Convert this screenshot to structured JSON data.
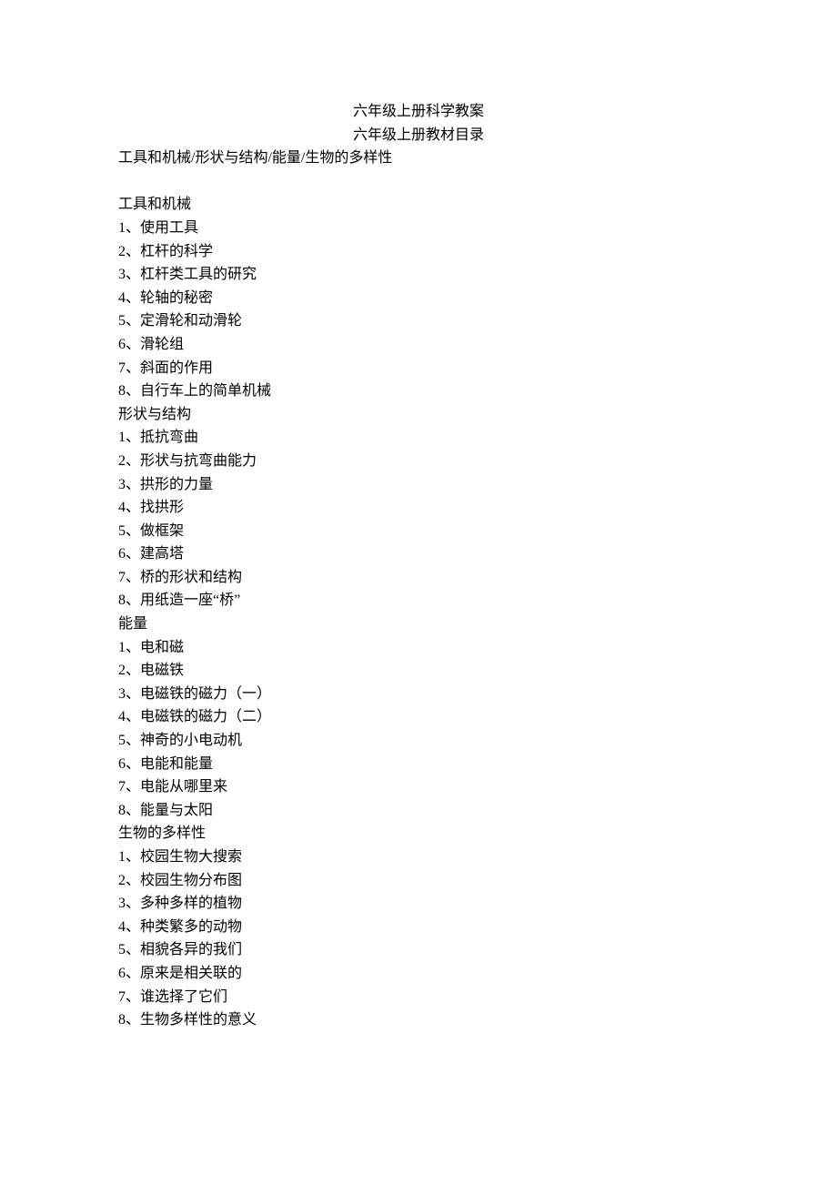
{
  "titles": {
    "main": "六年级上册科学教案",
    "sub": "六年级上册教材目录"
  },
  "summary": "工具和机械/形状与结构/能量/生物的多样性",
  "sections": [
    {
      "heading": "工具和机械",
      "items": [
        "1、使用工具",
        "2、杠杆的科学",
        "3、杠杆类工具的研究",
        "4、轮轴的秘密",
        "5、定滑轮和动滑轮",
        "6、滑轮组",
        "7、斜面的作用",
        "8、自行车上的简单机械"
      ]
    },
    {
      "heading": "形状与结构",
      "items": [
        "1、抵抗弯曲",
        "2、形状与抗弯曲能力",
        "3、拱形的力量",
        "4、找拱形",
        "5、做框架",
        "6、建高塔",
        "7、桥的形状和结构",
        "8、用纸造一座“桥”"
      ]
    },
    {
      "heading": "能量",
      "items": [
        "1、电和磁",
        "2、电磁铁",
        "3、电磁铁的磁力（一）",
        "4、电磁铁的磁力（二）",
        "5、神奇的小电动机",
        "6、电能和能量",
        "7、电能从哪里来",
        "8、能量与太阳"
      ]
    },
    {
      "heading": "生物的多样性",
      "items": [
        "1、校园生物大搜索",
        "2、校园生物分布图",
        "3、多种多样的植物",
        "4、种类繁多的动物",
        "5、相貌各异的我们",
        "6、原来是相关联的",
        "7、谁选择了它们",
        "8、生物多样性的意义"
      ]
    }
  ]
}
